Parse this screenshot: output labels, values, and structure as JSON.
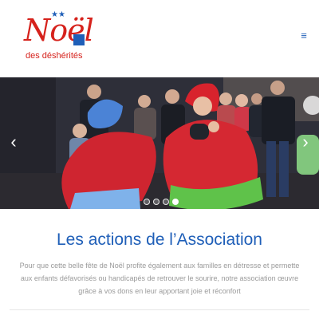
{
  "header": {
    "logo_title": "Noël",
    "logo_stars": "★★",
    "logo_subtitle": "des déshérités",
    "menu_icon": "≡"
  },
  "slider": {
    "prev_arrow": "‹",
    "next_arrow": "›",
    "dots": [
      {
        "active": false
      },
      {
        "active": false
      },
      {
        "active": false
      },
      {
        "active": true
      }
    ]
  },
  "main": {
    "section_title": "Les actions de l’Association",
    "section_text": "Pour que cette belle fête de Noël profite également aux familles en détresse et permette aux enfants défavorisés ou handicapés de retrouver le sourire, notre association œuvre grâce à vos dons en leur apportant joie et réconfort"
  },
  "colors": {
    "brand_red": "#d6221c",
    "brand_blue": "#1f5fb8",
    "text_gray": "#9a9a9a"
  }
}
